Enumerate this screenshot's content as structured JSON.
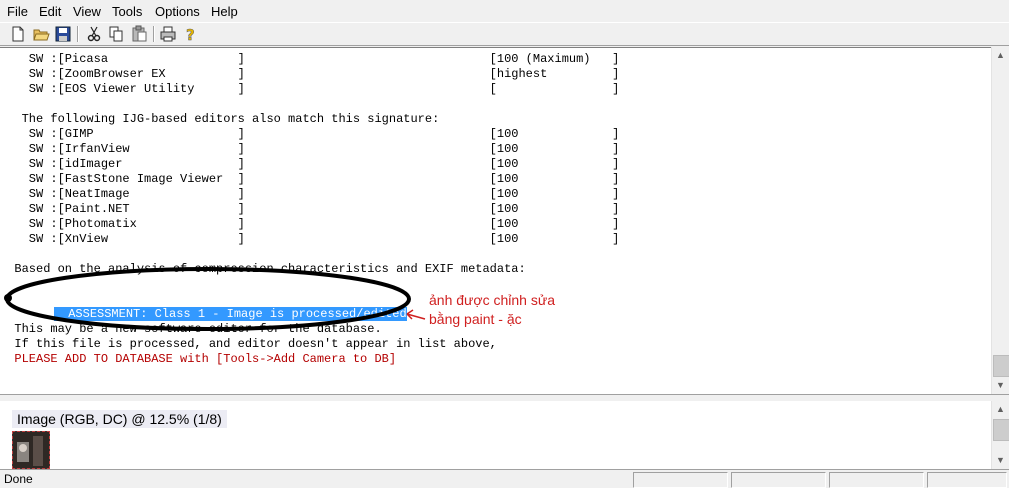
{
  "menu": [
    "File",
    "Edit",
    "View",
    "Tools",
    "Options",
    "Help"
  ],
  "toolbar_icons": [
    "new-icon",
    "open-icon",
    "save-icon",
    "cut-icon",
    "copy-icon",
    "paste-icon",
    "print-icon",
    "help-icon"
  ],
  "report_lines": [
    "    SW :[Picasa                  ]                                  [100 (Maximum)   ]",
    "    SW :[ZoomBrowser EX          ]                                  [highest         ]",
    "    SW :[EOS Viewer Utility      ]                                  [                ]",
    "",
    "   The following IJG-based editors also match this signature:",
    "    SW :[GIMP                    ]                                  [100             ]",
    "    SW :[IrfanView               ]                                  [100             ]",
    "    SW :[idImager                ]                                  [100             ]",
    "    SW :[FastStone Image Viewer  ]                                  [100             ]",
    "    SW :[NeatImage               ]                                  [100             ]",
    "    SW :[Paint.NET               ]                                  [100             ]",
    "    SW :[Photomatix              ]                                  [100             ]",
    "    SW :[XnView                  ]                                  [100             ]",
    "",
    "  Based on the analysis of compression characteristics and EXIF metadata:",
    "",
    "  ASSESSMENT: Class 1 - Image is processed/edited",
    "",
    "  This may be a new software editor for the database.",
    "  If this file is processed, and editor doesn't appear in list above,",
    "  PLEASE ADD TO DATABASE with [Tools->Add Camera to DB]"
  ],
  "annotation": {
    "line1": "ảnh được chỉnh sửa",
    "line2": "bằng paint - ặc"
  },
  "image_panel": {
    "label": "Image (RGB, DC) @ 12.5% (1/8)"
  },
  "status": {
    "text": "Done"
  },
  "colors": {
    "highlight": "#3399ff",
    "annotation_red": "#d02020",
    "warning_text": "#b40000"
  }
}
